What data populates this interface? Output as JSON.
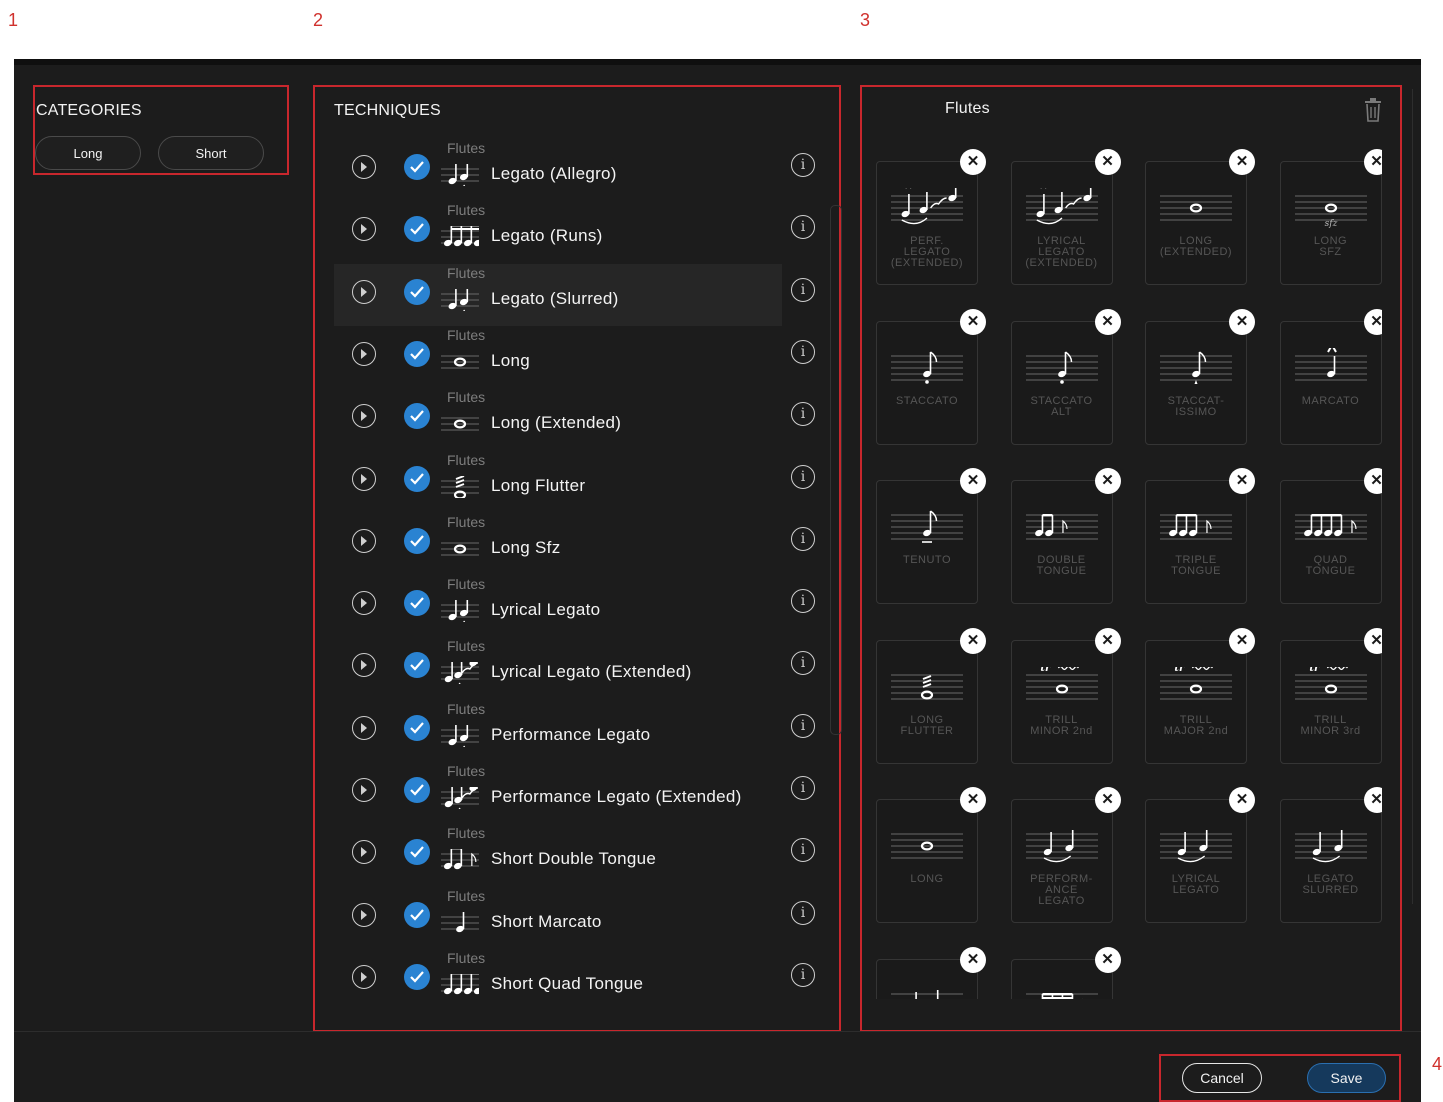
{
  "callouts": [
    "1",
    "2",
    "3",
    "4"
  ],
  "categories": {
    "title": "CATEGORIES",
    "items": [
      "Long",
      "Short"
    ]
  },
  "techniques": {
    "title": "TECHNIQUES",
    "rows": [
      {
        "category": "Flutes",
        "name": "Legato (Allegro)",
        "icon": "legato-icon",
        "checked": true
      },
      {
        "category": "Flutes",
        "name": "Legato (Runs)",
        "icon": "runs-icon",
        "checked": true
      },
      {
        "category": "Flutes",
        "name": "Legato (Slurred)",
        "icon": "legato-icon",
        "checked": true,
        "selected": true
      },
      {
        "category": "Flutes",
        "name": "Long",
        "icon": "whole-note-icon",
        "checked": true
      },
      {
        "category": "Flutes",
        "name": "Long (Extended)",
        "icon": "whole-note-icon",
        "checked": true
      },
      {
        "category": "Flutes",
        "name": "Long Flutter",
        "icon": "flutter-icon",
        "checked": true
      },
      {
        "category": "Flutes",
        "name": "Long Sfz",
        "icon": "sfz-icon",
        "checked": true
      },
      {
        "category": "Flutes",
        "name": "Lyrical Legato",
        "icon": "legato-icon",
        "checked": true
      },
      {
        "category": "Flutes",
        "name": "Lyrical Legato (Extended)",
        "icon": "legato-extended-icon",
        "checked": true
      },
      {
        "category": "Flutes",
        "name": "Performance Legato",
        "icon": "legato-icon",
        "checked": true
      },
      {
        "category": "Flutes",
        "name": "Performance Legato (Extended)",
        "icon": "legato-extended-icon",
        "checked": true
      },
      {
        "category": "Flutes",
        "name": "Short Double Tongue",
        "icon": "double-tongue-icon",
        "checked": true
      },
      {
        "category": "Flutes",
        "name": "Short Marcato",
        "icon": "marcato-icon",
        "checked": true
      },
      {
        "category": "Flutes",
        "name": "Short Quad Tongue",
        "icon": "quad-tongue-icon",
        "checked": true
      }
    ]
  },
  "preset": {
    "title": "Flutes",
    "tiles": [
      {
        "label": "PERF.\nLEGATO\n(EXTENDED)",
        "icon": "legato-extended-icon"
      },
      {
        "label": "LYRICAL\nLEGATO\n(EXTENDED)",
        "icon": "legato-extended-icon"
      },
      {
        "label": "LONG\n(EXTENDED)",
        "icon": "whole-note-icon"
      },
      {
        "label": "LONG\nSFZ",
        "icon": "sfz-icon"
      },
      {
        "label": "STACCATO",
        "icon": "staccato-icon"
      },
      {
        "label": "STACCATO\nALT",
        "icon": "staccato-icon"
      },
      {
        "label": "STACCAT-\nISSIMO",
        "icon": "staccatissimo-icon"
      },
      {
        "label": "MARCATO",
        "icon": "marcato-icon"
      },
      {
        "label": "TENUTO",
        "icon": "tenuto-icon"
      },
      {
        "label": "DOUBLE\nTONGUE",
        "icon": "double-tongue-icon"
      },
      {
        "label": "TRIPLE\nTONGUE",
        "icon": "triple-tongue-icon"
      },
      {
        "label": "QUAD\nTONGUE",
        "icon": "quad-tongue-icon"
      },
      {
        "label": "LONG\nFLUTTER",
        "icon": "flutter-icon"
      },
      {
        "label": "TRILL\nMINOR 2nd",
        "icon": "trill-icon"
      },
      {
        "label": "TRILL\nMAJOR 2nd",
        "icon": "trill-icon"
      },
      {
        "label": "TRILL\nMINOR 3rd",
        "icon": "trill-icon"
      },
      {
        "label": "LONG",
        "icon": "whole-note-icon"
      },
      {
        "label": "PERFORM-\nANCE\nLEGATO",
        "icon": "legato-icon"
      },
      {
        "label": "LYRICAL\nLEGATO",
        "icon": "legato-icon"
      },
      {
        "label": "LEGATO\nSLURRED",
        "icon": "legato-icon"
      },
      {
        "label": "",
        "icon": "legato-icon"
      },
      {
        "label": "",
        "icon": "runs-icon"
      }
    ],
    "trill_text": "tr",
    "sfz_text": "sfz"
  },
  "footer": {
    "cancel_label": "Cancel",
    "save_label": "Save"
  },
  "colors": {
    "accent": "#2a83d2",
    "highlight": "#c8272d",
    "background": "#1c1c1c"
  }
}
